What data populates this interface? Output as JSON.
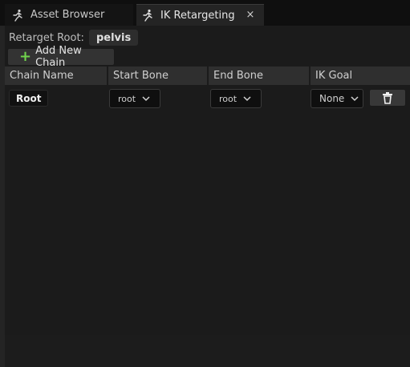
{
  "tabs": [
    {
      "label": "Asset Browser",
      "icon": "running-figure-icon",
      "active": false
    },
    {
      "label": "IK Retargeting",
      "icon": "running-figure-icon",
      "active": true,
      "close": "×"
    }
  ],
  "retarget_root": {
    "label": "Retarget Root:",
    "value": "pelvis"
  },
  "add_chain_button": {
    "icon": "plus-icon",
    "label": "Add New Chain",
    "icon_color": "#71d44d"
  },
  "table": {
    "columns": [
      "Chain Name",
      "Start Bone",
      "End Bone",
      "IK Goal"
    ],
    "rows": [
      {
        "chain_name": "Root",
        "start_bone": "root",
        "end_bone": "root",
        "ik_goal": "None",
        "delete_icon": "trash-icon"
      }
    ]
  }
}
